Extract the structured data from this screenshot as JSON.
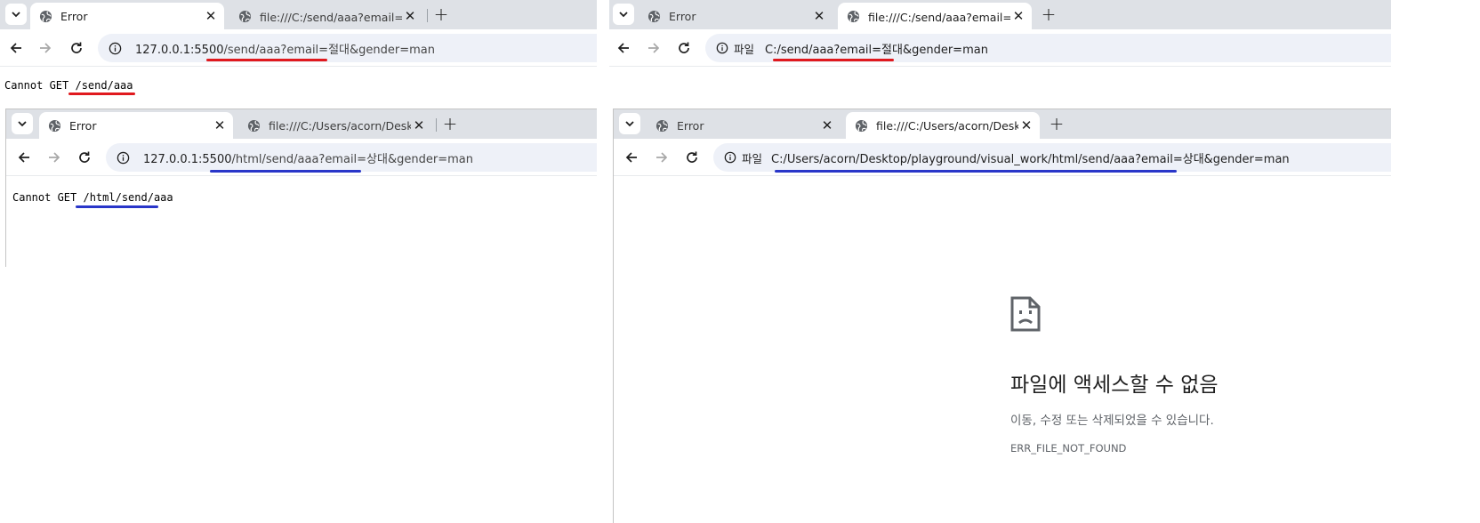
{
  "panels": {
    "top_left": {
      "tabs": [
        {
          "title": "Error",
          "active": true
        },
        {
          "title": "file:///C:/send/aaa?email=절대",
          "active": false
        }
      ],
      "url_host": "127.0.0.1:5500",
      "url_path": "/send/aaa?email=절대&gender=man",
      "body_prefix": "Cannot GET ",
      "body_path": "/send/aaa"
    },
    "top_right": {
      "tabs": [
        {
          "title": "Error",
          "active": false
        },
        {
          "title": "file:///C:/send/aaa?email=절대",
          "active": true
        }
      ],
      "chip_label": "파일",
      "url": "C:/send/aaa?email=절대&gender=man"
    },
    "bottom_left": {
      "tabs": [
        {
          "title": "Error",
          "active": true
        },
        {
          "title": "file:///C:/Users/acorn/Desktop/",
          "active": false
        }
      ],
      "url_host": "127.0.0.1:5500",
      "url_path": "/html/send/aaa?email=상대&gender=man",
      "body_prefix": "Cannot GET ",
      "body_path": "/html/send/aaa"
    },
    "bottom_right": {
      "tabs": [
        {
          "title": "Error",
          "active": false
        },
        {
          "title": "file:///C:/Users/acorn/Desktop/",
          "active": true
        }
      ],
      "chip_label": "파일",
      "url": "C:/Users/acorn/Desktop/playground/visual_work/html/send/aaa?email=상대&gender=man",
      "error_heading": "파일에 액세스할 수 없음",
      "error_sub": "이동, 수정 또는 삭제되었을 수 있습니다.",
      "error_code": "ERR_FILE_NOT_FOUND"
    }
  },
  "icons": {
    "tab_search": "chevron-down-icon",
    "favicon": "globe-icon",
    "close": "close-icon",
    "new_tab": "plus-icon",
    "back": "arrow-left-icon",
    "forward": "arrow-right-icon",
    "reload": "reload-icon",
    "site_info": "info-icon",
    "error_page": "sad-file-icon"
  },
  "colors": {
    "red_underline": "#e0191e",
    "blue_underline": "#2936c9",
    "tabstrip": "#dee1e6",
    "omnibox": "#eef1f8"
  }
}
